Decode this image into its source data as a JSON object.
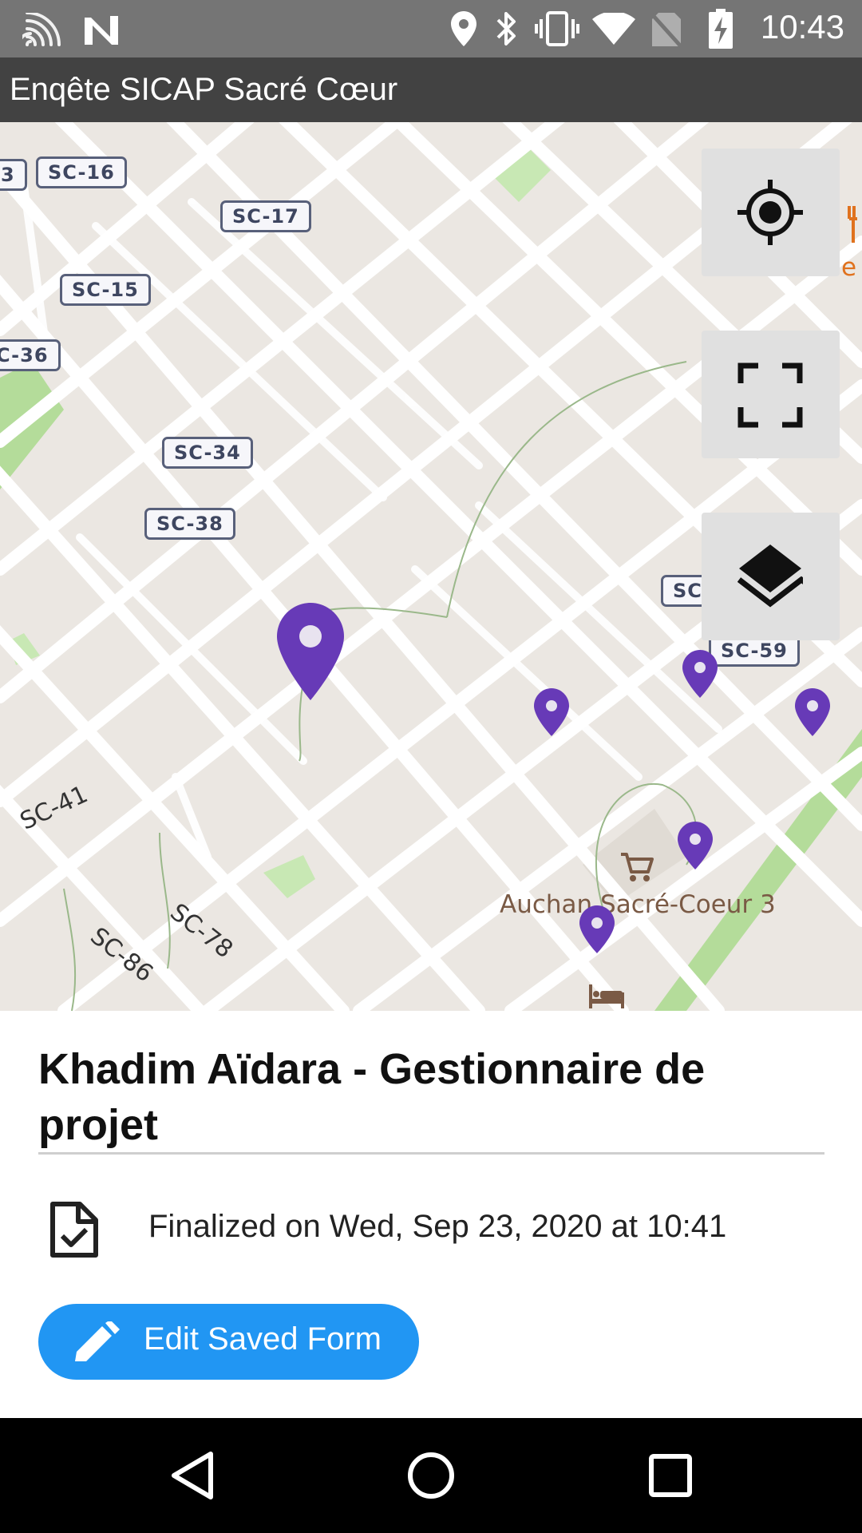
{
  "status_bar": {
    "time": "10:43",
    "icons": [
      "cast-icon",
      "n-icon",
      "location-icon",
      "bluetooth-icon",
      "vibrate-icon",
      "wifi-icon",
      "no-sim-icon",
      "battery-charging-icon"
    ]
  },
  "app_bar": {
    "title": "Enqête SICAP Sacré Cœur"
  },
  "map": {
    "road_labels": [
      "3",
      "SC-16",
      "SC-17",
      "SC-15",
      "C-36",
      "SC-34",
      "SC-38",
      "SC",
      "SC-59"
    ],
    "rotated_labels": [
      "SC-41",
      "SC-78",
      "SC-86"
    ],
    "poi_label": "Auchan Sacré-Coeur 3",
    "poi_partial_label": "e",
    "controls": [
      "my-location-icon",
      "fullscreen-icon",
      "layers-icon"
    ],
    "marker_color": "#673ab7"
  },
  "sheet": {
    "title": "Khadim Aïdara - Gestionnaire de projet",
    "status": "Finalized on Wed, Sep 23, 2020 at 10:41",
    "button_label": "Edit Saved Form",
    "button_color": "#2196f3"
  },
  "nav_bar": {
    "icons": [
      "back-icon",
      "home-icon",
      "recents-icon"
    ]
  }
}
